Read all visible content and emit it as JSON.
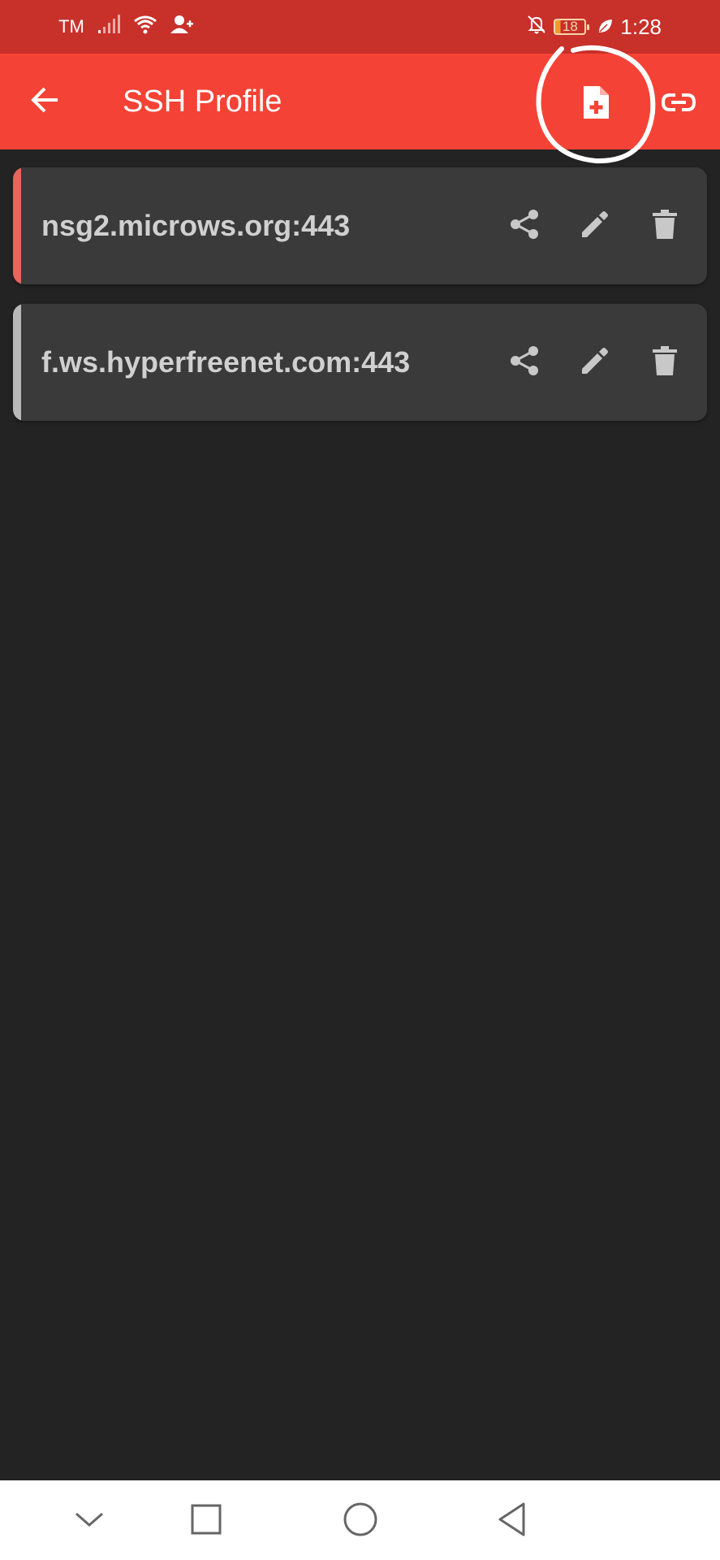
{
  "status_bar": {
    "carrier": "TM",
    "battery_level": "18",
    "time": "1:28",
    "icons": [
      "signal-icon",
      "wifi-icon",
      "contact-add-icon",
      "bell-off-icon",
      "battery-icon",
      "leaf-icon"
    ]
  },
  "app_bar": {
    "title": "SSH Profile",
    "icons": [
      "arrow-back-icon",
      "add-file-icon",
      "link-icon"
    ],
    "background_color": "#f44336"
  },
  "profiles": [
    {
      "name": "nsg2.microws.org:443",
      "accent_color": "#e8645c"
    },
    {
      "name": "f.ws.hyperfreenet.com:443",
      "accent_color": "#b8b8b8"
    }
  ],
  "card_action_icons": [
    "share-icon",
    "edit-icon",
    "delete-icon"
  ],
  "nav_bar": {
    "icons": [
      "chevron-down-icon",
      "recent-apps-icon",
      "home-icon",
      "back-triangle-icon"
    ]
  },
  "colors": {
    "status_bar": "#c8302a",
    "background": "#232323",
    "card": "#3a3a3a",
    "card_text": "#d0d0d0",
    "icon": "#c8c8c8"
  }
}
